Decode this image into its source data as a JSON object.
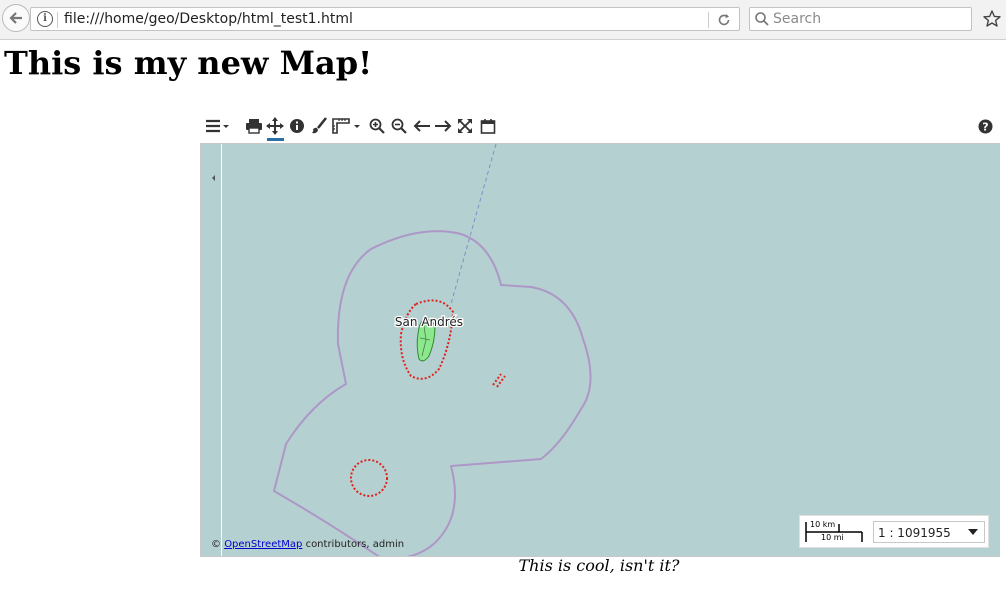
{
  "browser": {
    "url": "file:///home/geo/Desktop/html_test1.html",
    "search_placeholder": "Search",
    "icons": [
      "back-arrow-icon",
      "info-icon",
      "reload-icon",
      "search-icon",
      "bookmark-star-icon"
    ]
  },
  "page": {
    "title": "This is my new Map!",
    "caption": "This is cool, isn't it?"
  },
  "map_toolbar": {
    "tools": [
      "menu-icon",
      "print-icon",
      "pan-icon",
      "info-icon",
      "style-brush-icon",
      "measure-ruler-icon",
      "zoom-in-icon",
      "zoom-out-icon",
      "back-arrow-icon",
      "forward-arrow-icon",
      "fullscreen-icon",
      "calendar-icon",
      "help-icon"
    ],
    "active_tool": "pan-icon"
  },
  "map": {
    "place_label": "San Andrés",
    "attribution_symbol": "©",
    "attribution_link": "OpenStreetMap",
    "attribution_rest": " contributors, admin",
    "scale_km": "10 km",
    "scale_mi": "10 mi",
    "scale_ratio": "1 : 1091955",
    "colors": {
      "water": "#b5d0d0",
      "land": "#8ce88c",
      "maritime_boundary": "#a999c8",
      "reef_outline": "#e0201e"
    }
  }
}
